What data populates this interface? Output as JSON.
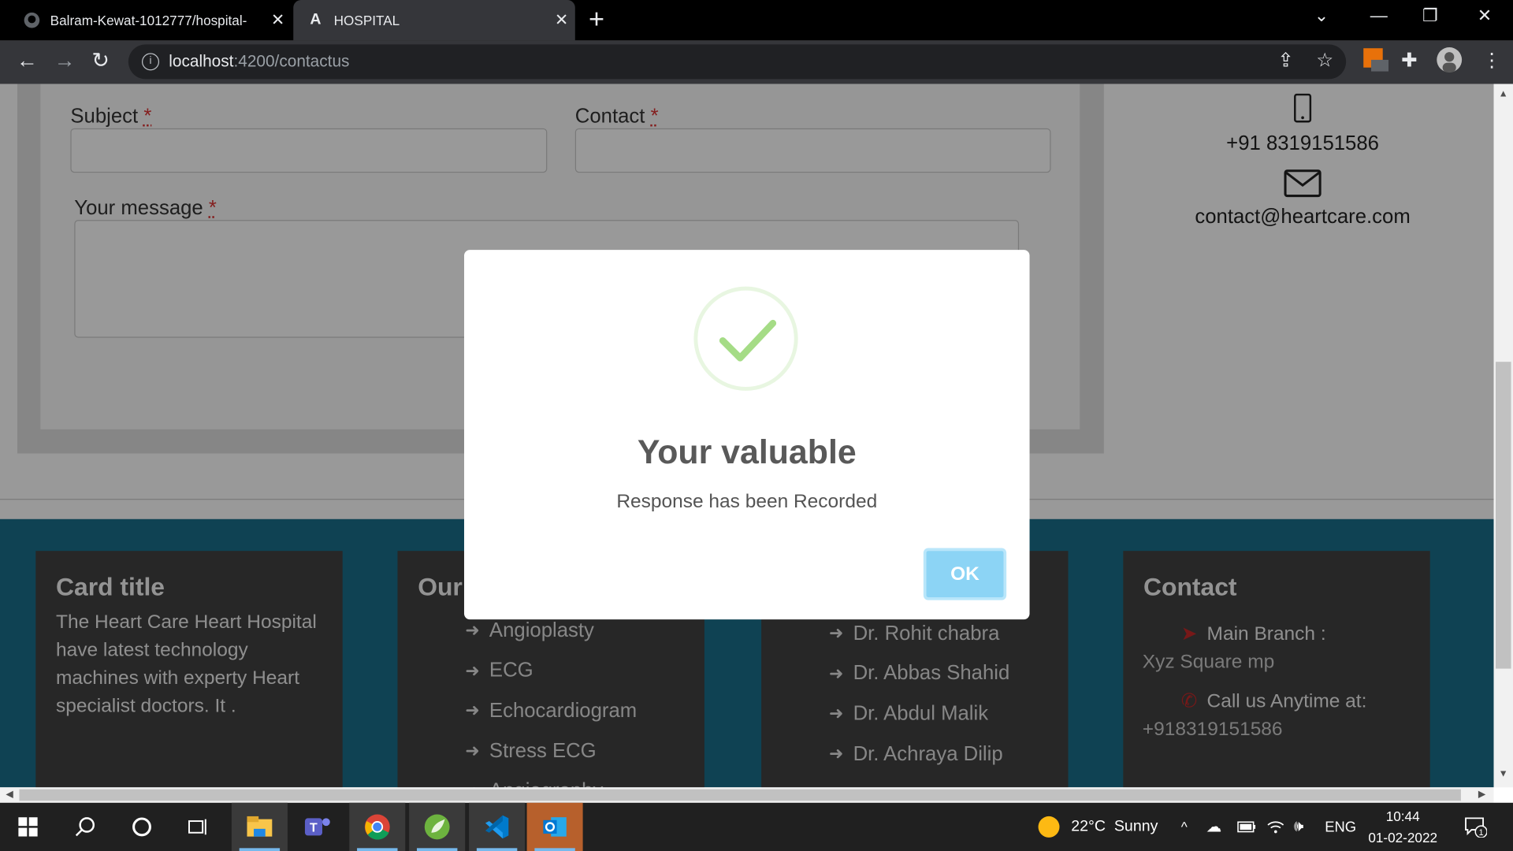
{
  "browser": {
    "tabs": [
      {
        "title": "Balram-Kewat-1012777/hospital-",
        "icon": "github-icon"
      },
      {
        "title": "HOSPITAL",
        "icon": "angular-icon",
        "active": true
      }
    ],
    "url_host": "localhost",
    "url_path": ":4200/contactus"
  },
  "form": {
    "subject_label": "Subject",
    "contact_label": "Contact",
    "message_label": "Your message",
    "required_mark": "*"
  },
  "side_contact": {
    "phone": "+91 8319151586",
    "email": "contact@heartcare.com"
  },
  "footer": {
    "card1": {
      "title": "Card title",
      "body": "The Heart Care Heart Hospital have latest technology machines with experty Heart specialist doctors. It ."
    },
    "card2": {
      "title": "Our",
      "items": [
        "Angioplasty",
        "ECG",
        "Echocardiogram",
        "Stress ECG",
        "Angiography"
      ]
    },
    "card3": {
      "items": [
        "Dr. Rohit chabra",
        "Dr. Abbas Shahid",
        "Dr. Abdul Malik",
        "Dr. Achraya Dilip"
      ]
    },
    "card4": {
      "title": "Contact",
      "branch_label": "Main Branch :",
      "branch_value": "Xyz Square mp",
      "call_label": "Call us Anytime at:",
      "call_value": "+918319151586"
    }
  },
  "modal": {
    "title": "Your valuable",
    "text": "Response has been Recorded",
    "ok_label": "OK",
    "success_color": "#a5dc86"
  },
  "taskbar": {
    "weather_temp": "22°C",
    "weather_text": "Sunny",
    "lang": "ENG",
    "time": "10:44",
    "date": "01-02-2022",
    "notif_count": "1"
  }
}
